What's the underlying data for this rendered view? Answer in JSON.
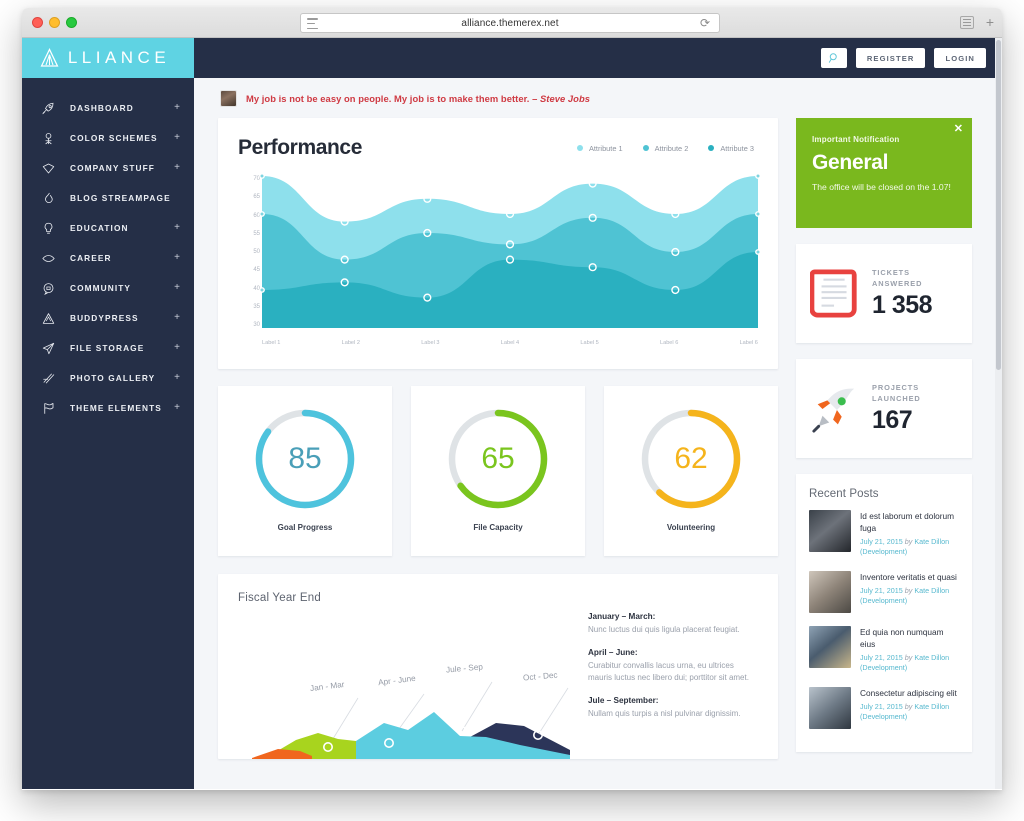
{
  "browser": {
    "url": "alliance.themerex.net",
    "reload_icon": "reload-icon",
    "sidebar_toggle_icon": "reader-icon",
    "new_tab_icon": "plus-icon"
  },
  "sidebar": {
    "logo": "LLIANCE",
    "items": [
      {
        "label": "DASHBOARD",
        "icon": "rocket-icon",
        "expandable": "+"
      },
      {
        "label": "COLOR SCHEMES",
        "icon": "palette-icon",
        "expandable": "+"
      },
      {
        "label": "COMPANY STUFF",
        "icon": "shield-icon",
        "expandable": "+"
      },
      {
        "label": "BLOG STREAMPAGE",
        "icon": "fire-icon",
        "expandable": ""
      },
      {
        "label": "EDUCATION",
        "icon": "bulb-icon",
        "expandable": "+"
      },
      {
        "label": "CAREER",
        "icon": "eye-icon",
        "expandable": "+"
      },
      {
        "label": "COMMUNITY",
        "icon": "chat-icon",
        "expandable": "+"
      },
      {
        "label": "BUDDYPRESS",
        "icon": "triangle-icon",
        "expandable": "+"
      },
      {
        "label": "FILE STORAGE",
        "icon": "paper-plane-icon",
        "expandable": "+"
      },
      {
        "label": "PHOTO GALLERY",
        "icon": "slashes-icon",
        "expandable": "+"
      },
      {
        "label": "THEME ELEMENTS",
        "icon": "flag-icon",
        "expandable": "+"
      }
    ]
  },
  "topbar": {
    "search_icon": "search-icon",
    "register_label": "REGISTER",
    "login_label": "LOGIN"
  },
  "quote": {
    "text": "My job is not be easy on people. My job is to make them better. – ",
    "author": "Steve Jobs",
    "avatar": "user-avatar"
  },
  "performance": {
    "title": "Performance",
    "legend": [
      {
        "label": "Attribute 1",
        "color": "#8ee0ec"
      },
      {
        "label": "Attribute 2",
        "color": "#4fc3d3"
      },
      {
        "label": "Attribute 3",
        "color": "#2ab0c0"
      }
    ]
  },
  "chart_data": [
    {
      "type": "area",
      "title": "Performance",
      "xlabel": "",
      "ylabel": "",
      "ylim": [
        30,
        70
      ],
      "grid": false,
      "legend_position": "top-right",
      "categories": [
        "Label 1",
        "Label 2",
        "Label 3",
        "Label 4",
        "Label 5",
        "Label 6",
        "Label 6"
      ],
      "series": [
        {
          "name": "Attribute 1",
          "color": "#8ee0ec",
          "values": [
            70,
            58,
            64,
            60,
            68,
            60,
            70
          ]
        },
        {
          "name": "Attribute 2",
          "color": "#4fc3d3",
          "values": [
            60,
            48,
            55,
            52,
            59,
            50,
            60
          ]
        },
        {
          "name": "Attribute 3",
          "color": "#2ab0c0",
          "values": [
            40,
            42,
            38,
            48,
            46,
            40,
            50
          ]
        }
      ],
      "yticks": [
        30,
        35,
        40,
        45,
        50,
        55,
        60,
        65,
        70
      ]
    },
    {
      "type": "area",
      "title": "Fiscal Year End",
      "annotations": [
        "Jan - Mar",
        "Apr - June",
        "Jule - Sep",
        "Oct - Dec"
      ],
      "series": [
        {
          "name": "Jan - Mar",
          "color": "#f0661e"
        },
        {
          "name": "Apr - June",
          "color": "#a8d41e"
        },
        {
          "name": "Jule - Sep",
          "color": "#5ccde0"
        },
        {
          "name": "Oct - Dec",
          "color": "#2c3559"
        }
      ]
    }
  ],
  "gauges": [
    {
      "label": "Goal Progress",
      "value": "85",
      "percent": 85,
      "color": "#4ec3dd"
    },
    {
      "label": "File Capacity",
      "value": "65",
      "percent": 65,
      "color": "#7ac51e"
    },
    {
      "label": "Volunteering",
      "value": "62",
      "percent": 62,
      "color": "#f5b41c"
    }
  ],
  "fiscal": {
    "title": "Fiscal Year End",
    "labels": [
      "Jan - Mar",
      "Apr - June",
      "Jule - Sep",
      "Oct - Dec"
    ],
    "blocks": [
      {
        "heading": "January – March:",
        "body": "Nunc luctus dui quis ligula placerat feugiat."
      },
      {
        "heading": "April – June:",
        "body": "Curabitur convallis lacus urna, eu ultrices mauris luctus nec libero dui; porttitor sit amet."
      },
      {
        "heading": "Jule – September:",
        "body": "Nullam quis turpis a nisl pulvinar dignissim."
      }
    ]
  },
  "notification": {
    "kicker": "Important Notification",
    "title": "General",
    "body": "The office will be closed on the 1.07!",
    "close_icon": "close-icon",
    "color": "#7ab81e"
  },
  "stats": [
    {
      "kicker": "TICKETS\nANSWERED",
      "kicker_line1": "TICKETS",
      "kicker_line2": "ANSWERED",
      "value": "1 358",
      "icon": "notepad-icon"
    },
    {
      "kicker_line1": "PROJECTS",
      "kicker_line2": "LAUNCHED",
      "value": "167",
      "icon": "rocket-icon"
    }
  ],
  "recent_posts": {
    "title": "Recent Posts",
    "items": [
      {
        "title": "Id est laborum et dolorum fuga",
        "date": "July 21, 2015",
        "by": "by",
        "author": "Kate Dillon",
        "category": "(Development)"
      },
      {
        "title": "Inventore veritatis et quasi",
        "date": "July 21, 2015",
        "by": "by",
        "author": "Kate Dillon",
        "category": "(Development)"
      },
      {
        "title": "Ed quia non numquam eius",
        "date": "July 21, 2015",
        "by": "by",
        "author": "Kate Dillon",
        "category": "(Development)"
      },
      {
        "title": "Consectetur adipiscing elit",
        "date": "July 21, 2015",
        "by": "by",
        "author": "Kate Dillon",
        "category": "(Development)"
      }
    ]
  },
  "colors": {
    "sidebar_bg": "#252f47",
    "logo_bg": "#5fd3e3",
    "page_bg": "#f4f6f9",
    "accent_teal": "#4fc3d3",
    "accent_green": "#7ab81e",
    "accent_orange": "#f5b41c",
    "quote_red": "#cf3a43"
  }
}
